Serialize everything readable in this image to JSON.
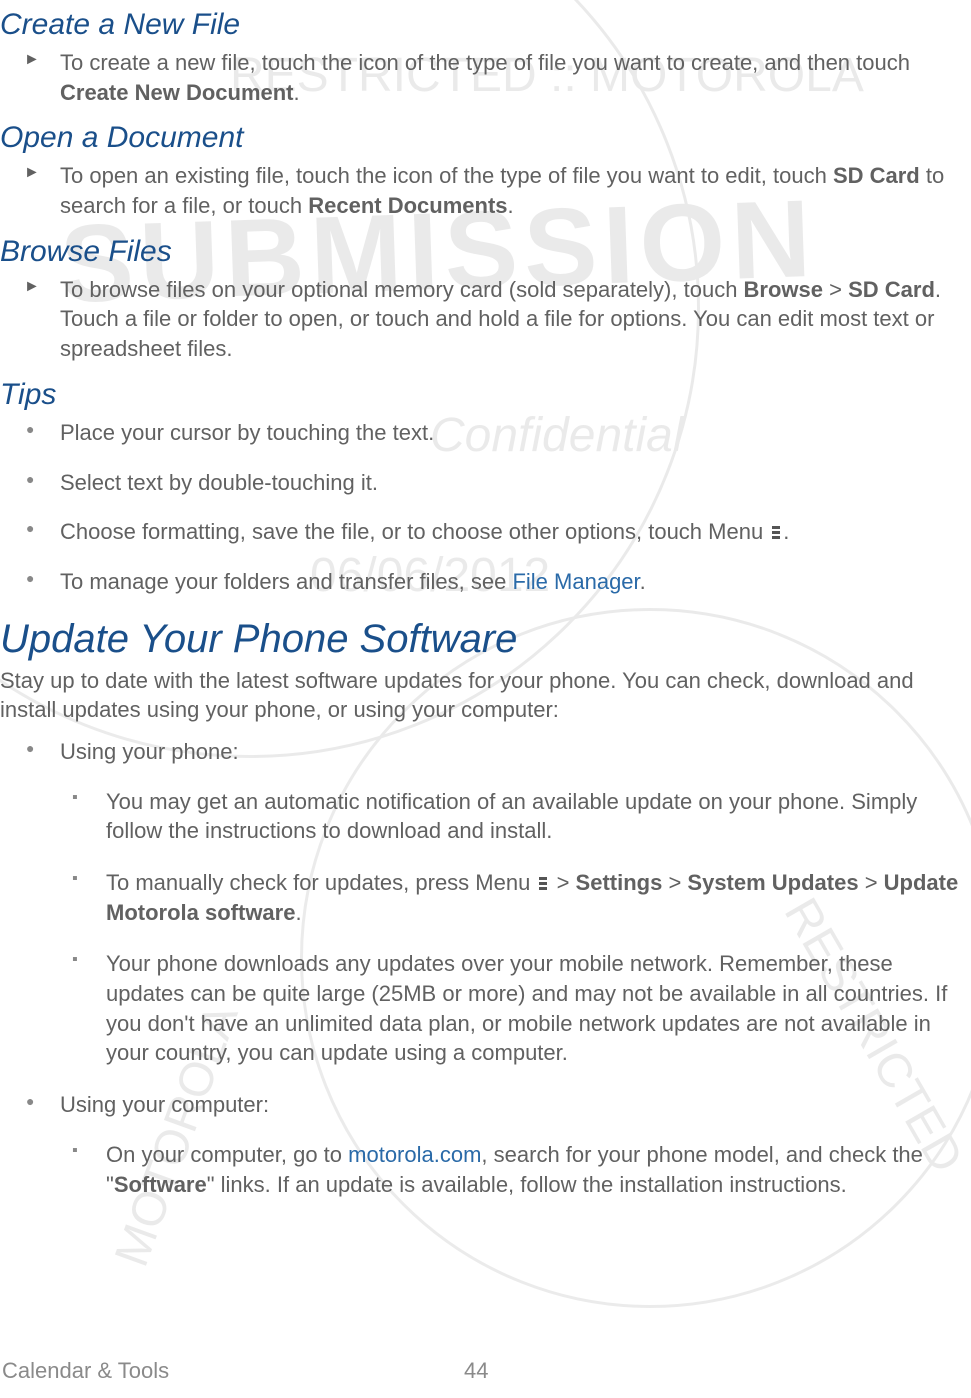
{
  "sections": {
    "create_file": {
      "title": "Create a New File",
      "item_pre": "To create a new file, touch the icon of the type of file you want to create, and then touch ",
      "item_bold": "Create New Document",
      "item_post": "."
    },
    "open_doc": {
      "title": "Open a Document",
      "item_pre": "To open an existing file, touch the icon of the type of file you want to edit, touch ",
      "item_bold1": "SD Card",
      "item_mid": " to search for a file, or touch ",
      "item_bold2": "Recent Documents",
      "item_post": "."
    },
    "browse_files": {
      "title": "Browse Files",
      "item_pre": "To browse files on your optional memory card (sold separately), touch ",
      "item_bold1": "Browse",
      "item_gt": " > ",
      "item_bold2": "SD Card",
      "item_post": ". Touch a file or folder to open, or touch and hold a file for options. You can edit most text or spreadsheet files."
    },
    "tips": {
      "title": "Tips",
      "tip1": "Place your cursor by touching the text.",
      "tip2": "Select text by double-touching it.",
      "tip3_pre": "Choose formatting, save the file, or to choose other options, touch Menu ",
      "tip3_post": ".",
      "tip4_pre": "To manage your folders and transfer files, see ",
      "tip4_link": "File Manager",
      "tip4_post": "."
    },
    "update": {
      "title": "Update Your Phone Software",
      "intro": "Stay up to date with the latest software updates for your phone. You can check, download and install updates using your phone, or using your computer:",
      "phone_label": "Using your phone:",
      "phone_sub1": "You may get an automatic notification of an available update on your phone. Simply follow the instructions to download and install.",
      "phone_sub2_pre": "To manually check for updates, press Menu ",
      "phone_sub2_gt1": " > ",
      "phone_sub2_b1": "Settings",
      "phone_sub2_gt2": " > ",
      "phone_sub2_b2": "System Updates",
      "phone_sub2_gt3": " > ",
      "phone_sub2_b3": "Update Motorola software",
      "phone_sub2_post": ".",
      "phone_sub3": "Your phone downloads any updates over your mobile network. Remember, these updates can be quite large (25MB or more) and may not be available in all countries. If you don't have an unlimited data plan, or mobile network updates are not available in your country, you can update using a computer.",
      "computer_label": "Using your computer:",
      "computer_sub1_pre": "On your computer, go to ",
      "computer_sub1_link": "motorola.com",
      "computer_sub1_mid": ", search for your phone model, and check the \"",
      "computer_sub1_bold": "Software",
      "computer_sub1_post": "\" links. If an update is available, follow the installation instructions."
    }
  },
  "footer": {
    "section": "Calendar & Tools",
    "page": "44"
  }
}
